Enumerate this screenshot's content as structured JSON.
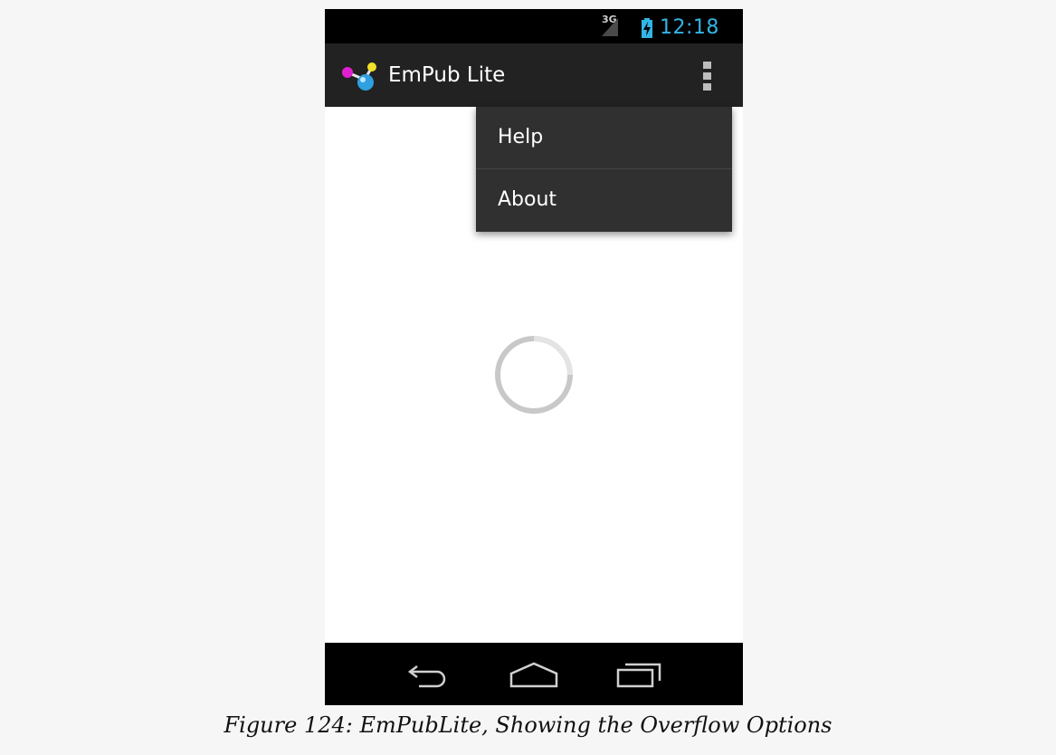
{
  "status_bar": {
    "network": "3G",
    "time": "12:18",
    "icons": [
      "signal-icon",
      "battery-charging-icon"
    ]
  },
  "action_bar": {
    "app_icon": "empub-logo-icon",
    "title": "EmPub Lite",
    "overflow_icon": "overflow-menu-icon"
  },
  "overflow_menu": {
    "items": [
      {
        "label": "Help"
      },
      {
        "label": "About"
      }
    ]
  },
  "content": {
    "loading_indicator": "progress-spinner-icon"
  },
  "nav_bar": {
    "buttons": [
      "back-icon",
      "home-icon",
      "recent-apps-icon"
    ]
  },
  "caption": "Figure 124: EmPubLite, Showing the Overflow Options",
  "colors": {
    "status_bar_bg": "#000000",
    "action_bar_bg": "#222222",
    "menu_bg": "#303030",
    "clock": "#33b5e5",
    "page_bg": "#f6f6f6"
  }
}
